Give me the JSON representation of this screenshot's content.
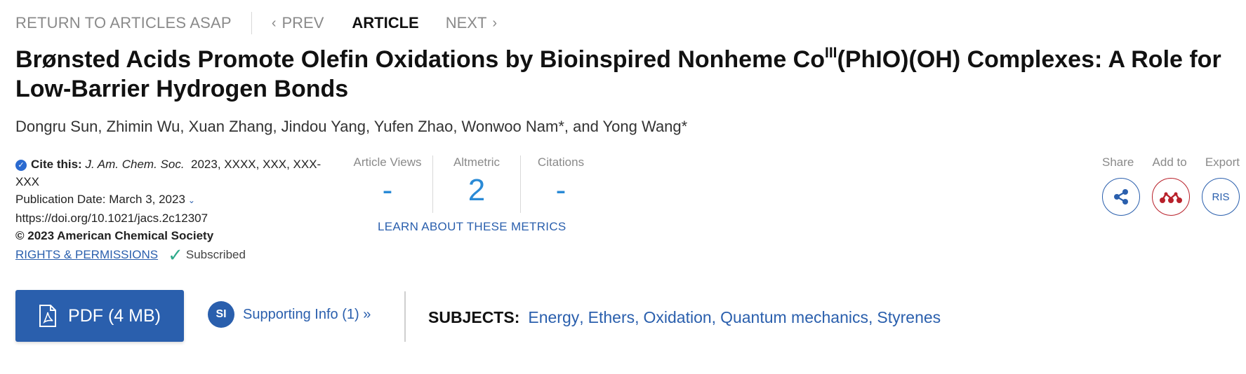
{
  "nav": {
    "return": "RETURN TO ARTICLES ASAP",
    "prev": "PREV",
    "article": "ARTICLE",
    "next": "NEXT"
  },
  "title": {
    "part1": "Brønsted Acids Promote Olefin Oxidations by Bioinspired Nonheme Co",
    "superscript": "III",
    "part2": "(PhIO)(OH) Complexes: A Role for Low-Barrier Hydrogen Bonds"
  },
  "authors": "Dongru Sun, Zhimin Wu, Xuan Zhang, Jindou Yang, Yufen Zhao, Wonwoo Nam*, and Yong Wang*",
  "citation": {
    "label": "Cite this:",
    "journal": "J. Am. Chem. Soc.",
    "ref": "2023, XXXX, XXX, XXX-XXX",
    "pub_date": "Publication Date: March 3, 2023",
    "doi": "https://doi.org/10.1021/jacs.2c12307",
    "copyright": "© 2023 American Chemical Society",
    "rights": "RIGHTS & PERMISSIONS",
    "subscribed": "Subscribed"
  },
  "metrics": {
    "views_label": "Article Views",
    "views_value": "-",
    "altmetric_label": "Altmetric",
    "altmetric_value": "2",
    "citations_label": "Citations",
    "citations_value": "-",
    "learn_more": "LEARN ABOUT THESE METRICS"
  },
  "actions": {
    "share": "Share",
    "add_to": "Add to",
    "export": "Export",
    "export_button": "RIS"
  },
  "pdf_button": "PDF (4 MB)",
  "supporting_info": {
    "badge": "SI",
    "label": "Supporting Info (1) »"
  },
  "subjects": {
    "label": "SUBJECTS:",
    "items": [
      "Energy",
      "Ethers",
      "Oxidation",
      "Quantum mechanics",
      "Styrenes"
    ]
  },
  "colors": {
    "link_blue": "#2a5fad",
    "metric_blue": "#2a8ad6",
    "mendeley_red": "#b8202a",
    "check_green": "#2faa8b"
  }
}
